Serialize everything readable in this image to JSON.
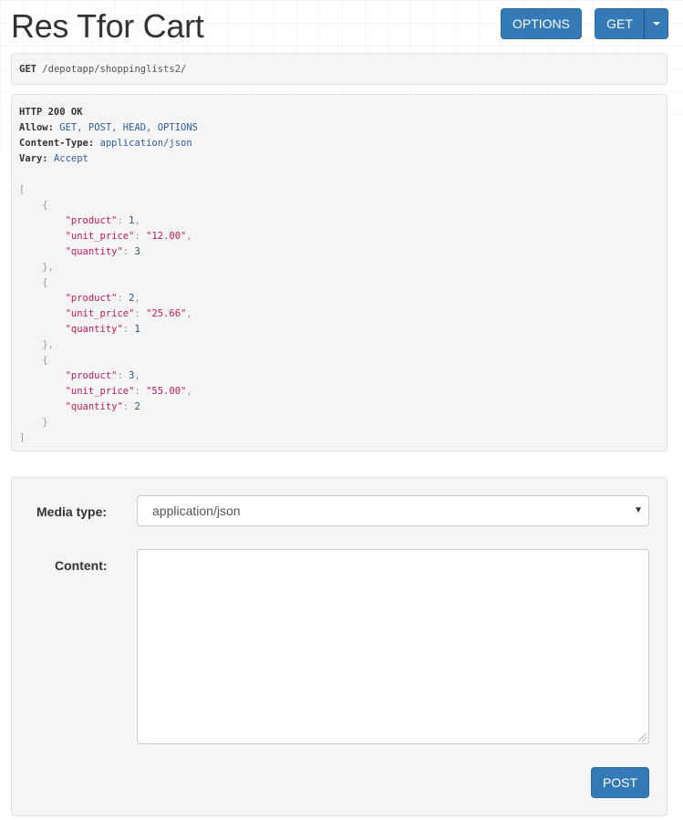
{
  "page": {
    "title": "Res Tfor Cart"
  },
  "toolbar": {
    "options_label": "OPTIONS",
    "get_label": "GET"
  },
  "request": {
    "method": "GET",
    "path": "/depotapp/shoppinglists2/"
  },
  "response": {
    "status_line": "HTTP 200 OK",
    "headers": [
      {
        "name": "Allow:",
        "value": "GET, POST, HEAD, OPTIONS"
      },
      {
        "name": "Content-Type:",
        "value": "application/json"
      },
      {
        "name": "Vary:",
        "value": "Accept"
      }
    ],
    "items": [
      {
        "product": "1",
        "unit_price": "\"12.00\"",
        "quantity": "3"
      },
      {
        "product": "2",
        "unit_price": "\"25.66\"",
        "quantity": "1"
      },
      {
        "product": "3",
        "unit_price": "\"55.00\"",
        "quantity": "2"
      }
    ]
  },
  "form": {
    "media_type_label": "Media type:",
    "media_type_value": "application/json",
    "content_label": "Content:",
    "content_value": "",
    "post_label": "POST"
  },
  "colors": {
    "primary": "#337ab7",
    "well_bg": "#f5f5f5"
  }
}
